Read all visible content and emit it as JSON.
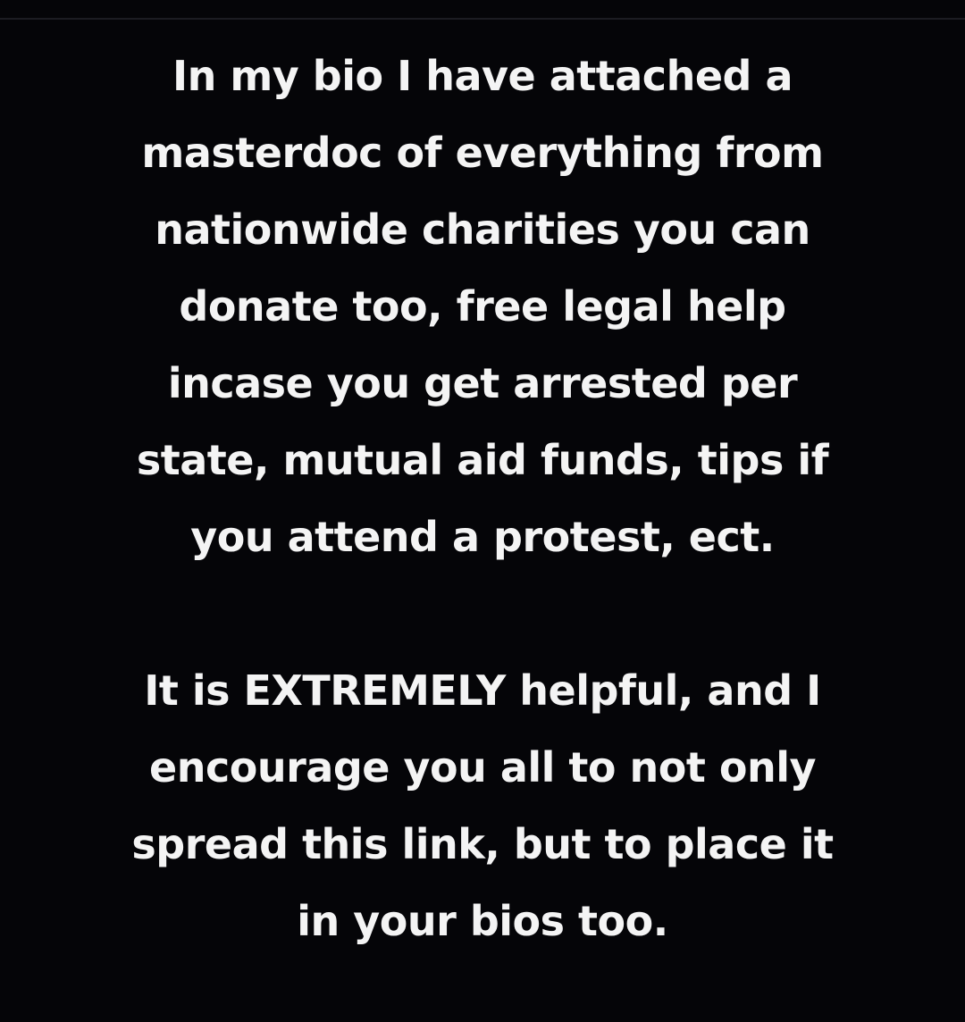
{
  "post": {
    "paragraphs": [
      {
        "lines": [
          "In my bio I have attached a",
          "masterdoc of everything from",
          "nationwide charities you can",
          "donate too, free legal help",
          "incase you get arrested per",
          "state, mutual aid funds, tips if",
          "you attend a protest, ect."
        ]
      },
      {
        "lines": [
          "It is EXTREMELY helpful, and I",
          "encourage you all to not only",
          "spread this link, but to place it",
          "in your bios too."
        ]
      }
    ]
  },
  "colors": {
    "background": "#050508",
    "text": "#f4f4f4"
  }
}
